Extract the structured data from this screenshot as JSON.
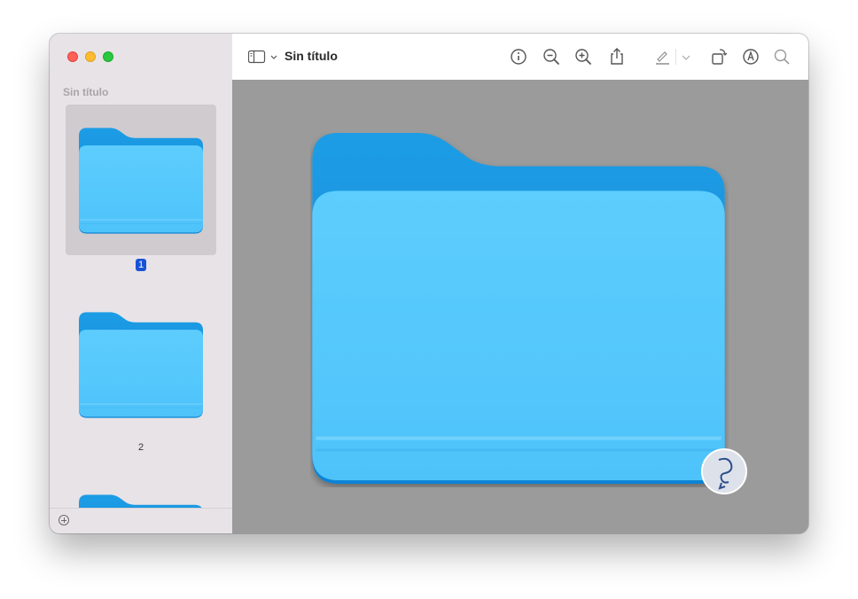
{
  "window": {
    "title": "Sin título"
  },
  "toolbar": {
    "title": "Sin título",
    "buttons": [
      {
        "icon": "info-icon"
      },
      {
        "icon": "zoom-out-icon"
      },
      {
        "icon": "zoom-in-icon"
      },
      {
        "icon": "share-icon"
      },
      {
        "icon": "highlight-pen-icon"
      },
      {
        "icon": "chevron-down-icon"
      },
      {
        "icon": "rotate-icon"
      },
      {
        "icon": "markup-icon"
      },
      {
        "icon": "search-icon"
      }
    ]
  },
  "sidebar": {
    "title": "Sin título",
    "pages": [
      {
        "number": "1",
        "selected": true
      },
      {
        "number": "2",
        "selected": false
      },
      {
        "number": "",
        "selected": false
      }
    ]
  },
  "colors": {
    "folder_back": "#1a96e0",
    "folder_front": "#54c8fb",
    "selection": "#1853d6",
    "canvas": "#9b9b9b"
  }
}
